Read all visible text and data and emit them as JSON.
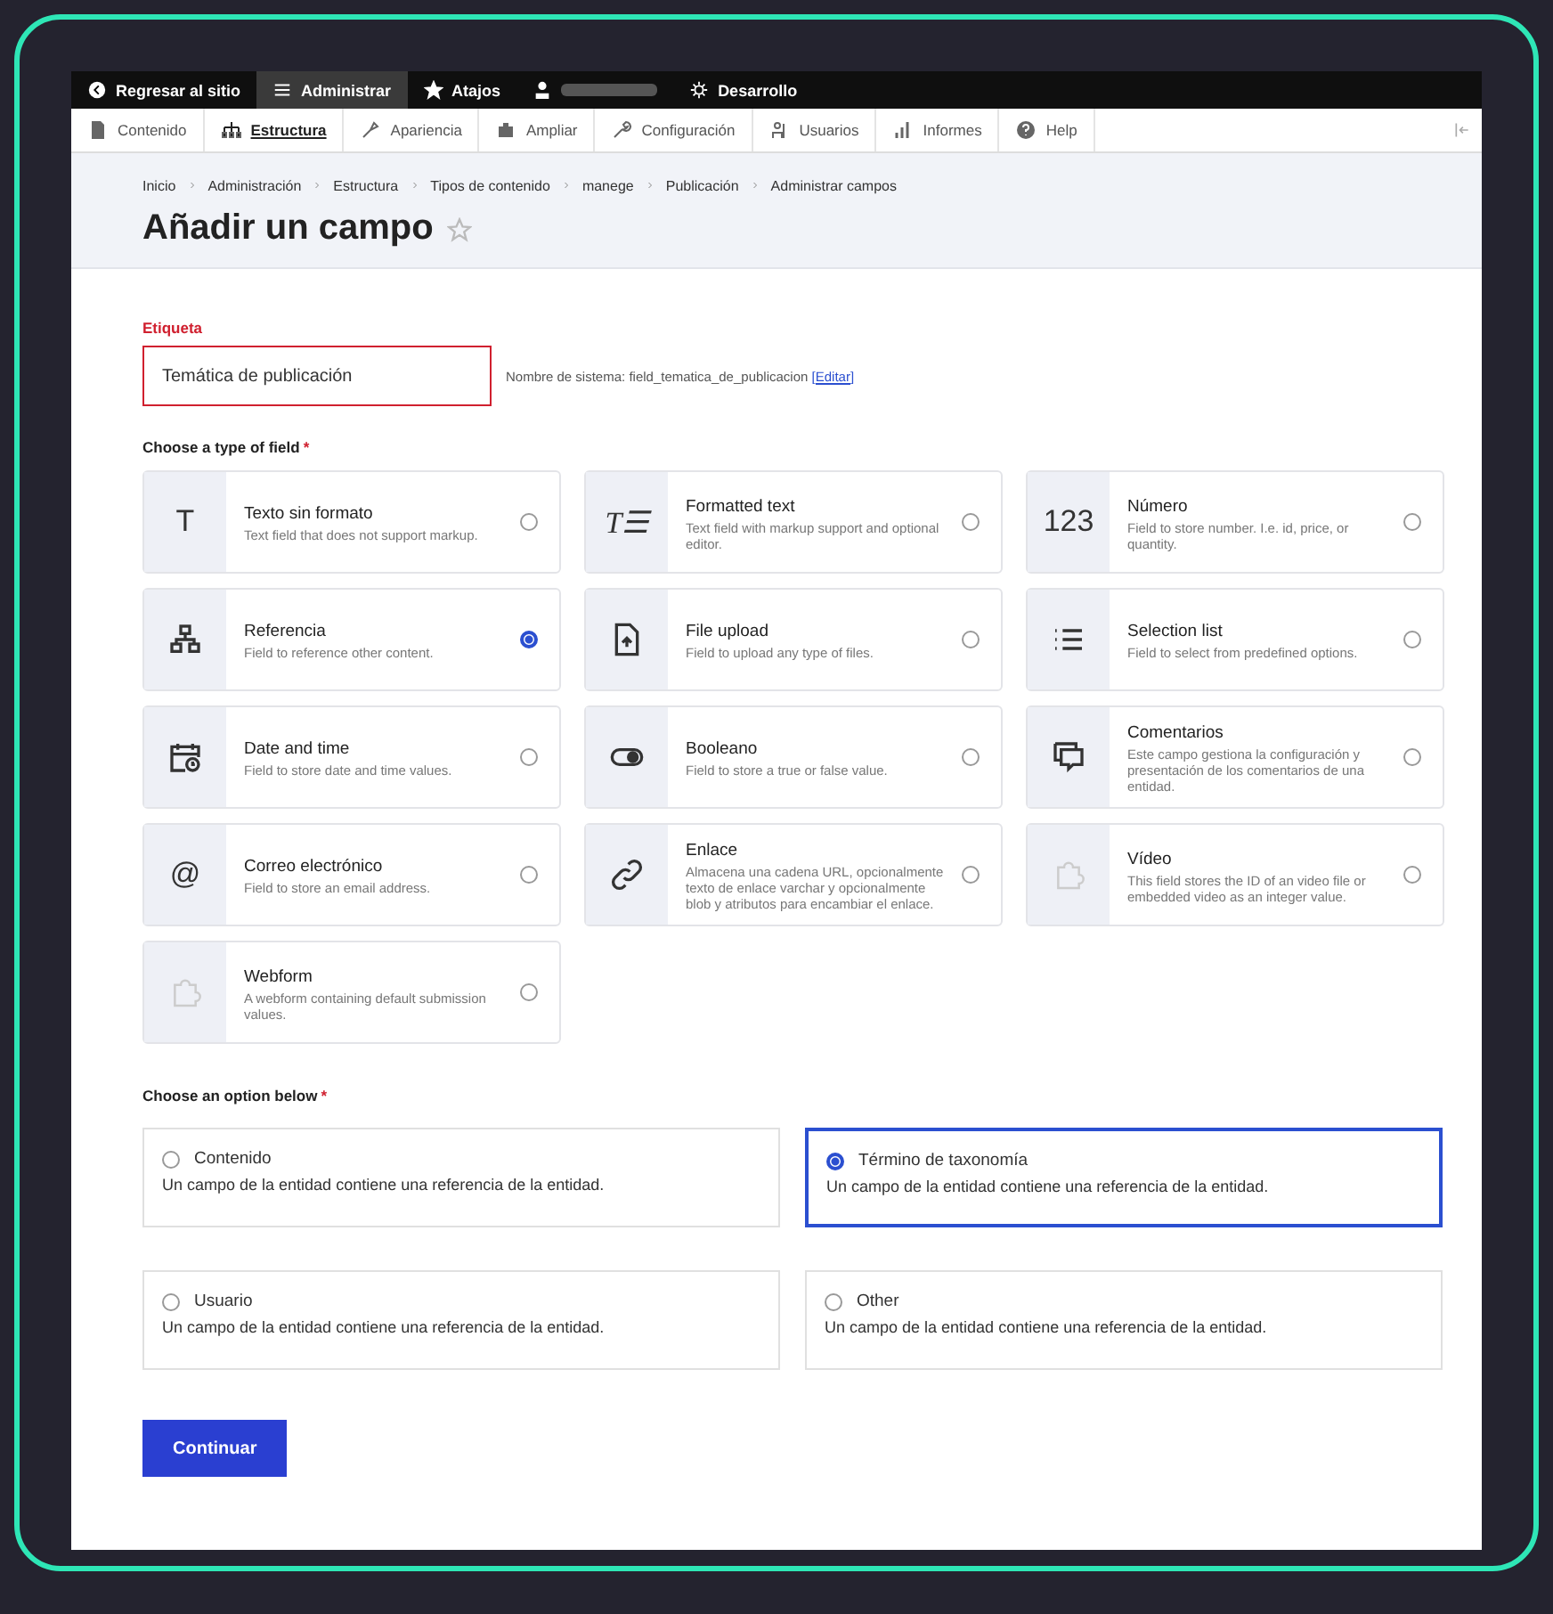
{
  "toolbar": {
    "items": [
      {
        "label": "Regresar al sitio",
        "selected": false
      },
      {
        "label": "Administrar",
        "selected": true
      },
      {
        "label": "Atajos",
        "selected": false
      },
      {
        "label": "Desarrollo",
        "selected": false
      }
    ]
  },
  "menu": {
    "items": [
      {
        "label": "Contenido",
        "selected": false
      },
      {
        "label": "Estructura",
        "selected": true
      },
      {
        "label": "Apariencia",
        "selected": false
      },
      {
        "label": "Ampliar",
        "selected": false
      },
      {
        "label": "Configuración",
        "selected": false
      },
      {
        "label": "Usuarios",
        "selected": false
      },
      {
        "label": "Informes",
        "selected": false
      },
      {
        "label": "Help",
        "selected": false
      }
    ]
  },
  "breadcrumb": [
    "Inicio",
    "Administración",
    "Estructura",
    "Tipos de contenido",
    "manege",
    "Publicación",
    "Administrar campos"
  ],
  "page_title": "Añadir un campo",
  "label_field": {
    "label": "Etiqueta",
    "value": "Temática de publicación",
    "machine_name": "Nombre de sistema: field_tematica_de_publicacion",
    "edit_link": "[Editar]"
  },
  "field_types": {
    "heading": "Choose a type of field",
    "required_mark": "*",
    "items": [
      {
        "title": "Texto sin formato",
        "description": "Text field that does not support markup.",
        "glyph": "T",
        "selected": false
      },
      {
        "title": "Formatted text",
        "description": "Text field with markup support and optional editor.",
        "glyph": "T☰",
        "selected": false
      },
      {
        "title": "Número",
        "description": "Field to store number. I.e. id, price, or quantity.",
        "glyph": "123",
        "selected": false
      },
      {
        "title": "Referencia",
        "description": "Field to reference other content.",
        "selected": true
      },
      {
        "title": "File upload",
        "description": "Field to upload any type of files.",
        "selected": false
      },
      {
        "title": "Selection list",
        "description": "Field to select from predefined options.",
        "selected": false
      },
      {
        "title": "Date and time",
        "description": "Field to store date and time values.",
        "selected": false
      },
      {
        "title": "Booleano",
        "description": "Field to store a true or false value.",
        "selected": false
      },
      {
        "title": "Comentarios",
        "description": "Este campo gestiona la configuración y presentación de los comentarios de una entidad.",
        "selected": false
      },
      {
        "title": "Correo electrónico",
        "description": "Field to store an email address.",
        "glyph": "@",
        "selected": false
      },
      {
        "title": "Enlace",
        "description": "Almacena una cadena URL, opcionalmente texto de enlace varchar y opcionalmente blob y atributos para encambiar el enlace.",
        "selected": false
      },
      {
        "title": "Vídeo",
        "description": "This field stores the ID of an video file or embedded video as an integer value.",
        "selected": false
      },
      {
        "title": "Webform",
        "description": "A webform containing default submission values.",
        "selected": false
      }
    ]
  },
  "options": {
    "heading": "Choose an option below",
    "required_mark": "*",
    "items": [
      {
        "title": "Contenido",
        "description": "Un campo de la entidad contiene una referencia de la entidad.",
        "selected": false
      },
      {
        "title": "Término de taxonomía",
        "description": "Un campo de la entidad contiene una referencia de la entidad.",
        "selected": true
      },
      {
        "title": "Usuario",
        "description": "Un campo de la entidad contiene una referencia de la entidad.",
        "selected": false
      },
      {
        "title": "Other",
        "description": "Un campo de la entidad contiene una referencia de la entidad.",
        "selected": false
      }
    ]
  },
  "submit": "Continuar"
}
